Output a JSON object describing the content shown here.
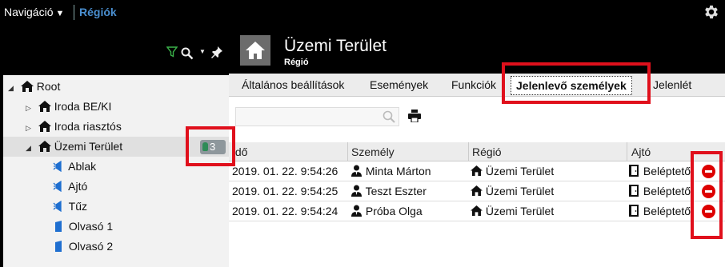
{
  "topbar": {
    "nav_label": "Navigáció",
    "breadcrumb": "Régiók",
    "settings_icon": "gear-icon"
  },
  "sidebar": {
    "toolbar_icons": [
      "filter-icon",
      "search-icon",
      "pin-icon"
    ],
    "tree": [
      {
        "label": "Root",
        "icon": "house-icon",
        "expanded": true
      },
      {
        "label": "Iroda BE/KI",
        "icon": "house-icon",
        "expanded": false
      },
      {
        "label": "Iroda riasztós",
        "icon": "house-icon",
        "expanded": false
      },
      {
        "label": "Üzemi Terület",
        "icon": "house-icon",
        "expanded": true,
        "selected": true,
        "badge": "3"
      },
      {
        "label": "Ablak",
        "icon": "door-sensor-icon"
      },
      {
        "label": "Ajtó",
        "icon": "door-sensor-icon"
      },
      {
        "label": "Tűz",
        "icon": "door-sensor-icon"
      },
      {
        "label": "Olvasó 1",
        "icon": "reader-icon"
      },
      {
        "label": "Olvasó 2",
        "icon": "reader-icon"
      }
    ]
  },
  "header": {
    "title": "Üzemi Terület",
    "subtitle": "Régió"
  },
  "tabs": [
    {
      "label": "Általános beállítások"
    },
    {
      "label": "Események"
    },
    {
      "label": "Funkciók"
    },
    {
      "label": "Jelenlevő személyek",
      "active": true
    },
    {
      "label": "Jelenlét"
    }
  ],
  "search": {
    "placeholder": "",
    "value": ""
  },
  "grid": {
    "columns": [
      "Idő",
      "Személy",
      "Régió",
      "Ajtó"
    ],
    "rows": [
      {
        "time": "2019. 01. 22. 9:54:26",
        "person": "Minta Márton",
        "region": "Üzemi Terület",
        "door": "Beléptető"
      },
      {
        "time": "2019. 01. 22. 9:54:25",
        "person": "Teszt Eszter",
        "region": "Üzemi Terület",
        "door": "Beléptető"
      },
      {
        "time": "2019. 01. 22. 9:54:24",
        "person": "Próba Olga",
        "region": "Üzemi Terület",
        "door": "Beléptető"
      }
    ]
  },
  "colors": {
    "accent": "#4a8fd0",
    "highlight": "#e0101c",
    "remove": "#dd0000"
  }
}
